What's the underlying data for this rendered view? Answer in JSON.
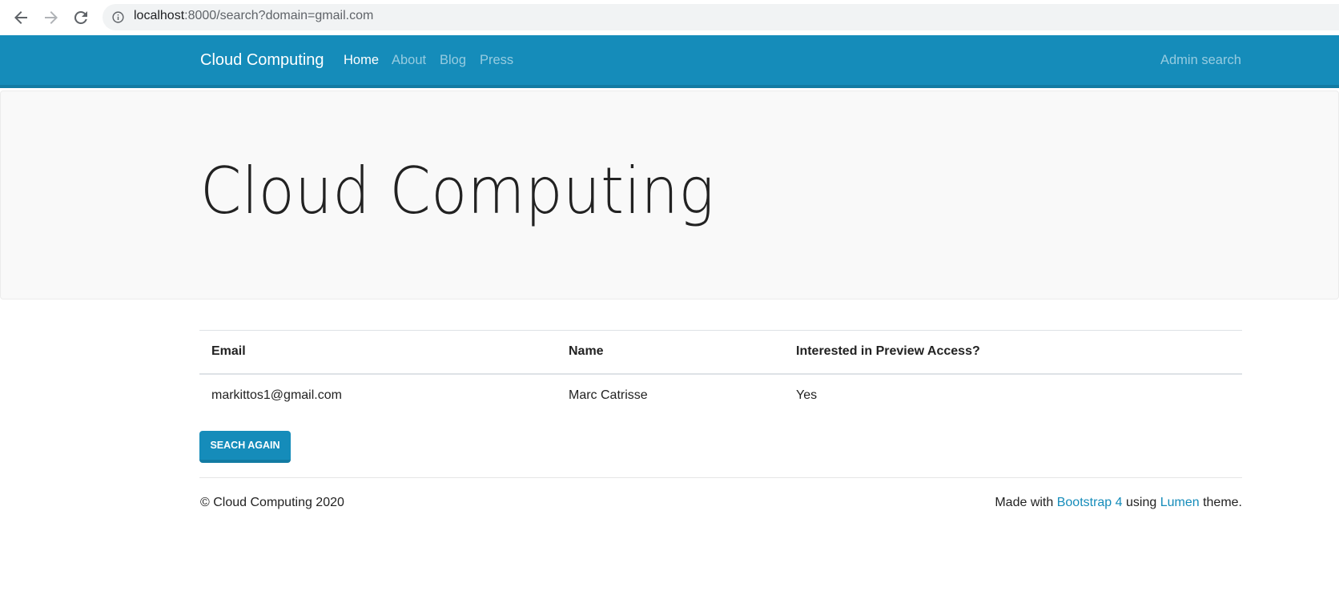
{
  "browser": {
    "url_host": "localhost",
    "url_rest": ":8000/search?domain=gmail.com",
    "back_icon": "back-arrow-icon",
    "forward_icon": "forward-arrow-icon",
    "reload_icon": "reload-icon",
    "info_icon": "info-icon"
  },
  "navbar": {
    "brand": "Cloud Computing",
    "links": [
      {
        "label": "Home",
        "active": true
      },
      {
        "label": "About",
        "active": false
      },
      {
        "label": "Blog",
        "active": false
      },
      {
        "label": "Press",
        "active": false
      }
    ],
    "right_link": "Admin search",
    "color": "#158cba"
  },
  "hero": {
    "title": "Cloud Computing"
  },
  "table": {
    "headers": [
      "Email",
      "Name",
      "Interested in Preview Access?"
    ],
    "rows": [
      [
        "markittos1@gmail.com",
        "Marc Catrisse",
        "Yes"
      ]
    ]
  },
  "actions": {
    "search_again": "SEACH AGAIN"
  },
  "footer": {
    "copyright": "© Cloud Computing 2020",
    "made_with": "Made with",
    "bootstrap_link": "Bootstrap 4",
    "using": "using",
    "theme_link": "Lumen",
    "theme_suffix": "theme."
  }
}
